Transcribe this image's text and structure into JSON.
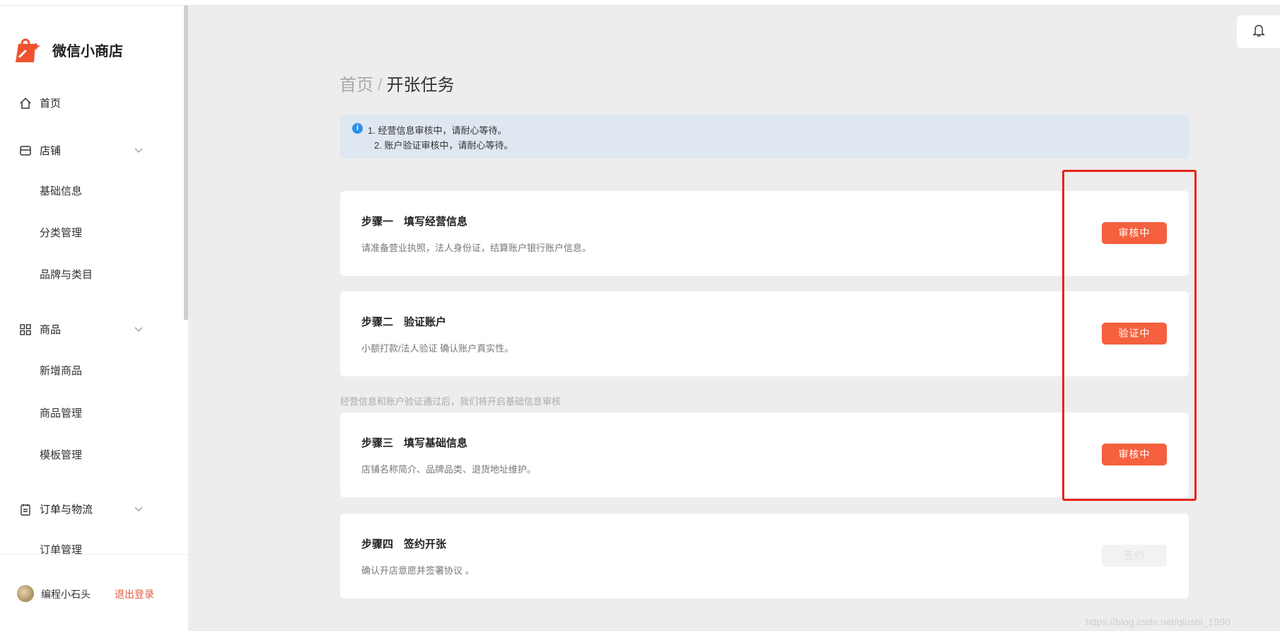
{
  "app": {
    "title": "微信小商店"
  },
  "sidebar": {
    "home": "首页",
    "store": {
      "label": "店铺",
      "items": [
        "基础信息",
        "分类管理",
        "品牌与类目"
      ]
    },
    "goods": {
      "label": "商品",
      "items": [
        "新增商品",
        "商品管理",
        "模板管理"
      ]
    },
    "orders": {
      "label": "订单与物流",
      "items": [
        "订单管理"
      ]
    },
    "footer": {
      "username": "编程小石头",
      "logout": "退出登录"
    }
  },
  "breadcrumb": {
    "home": "首页",
    "separator": "/",
    "current": "开张任务"
  },
  "notice": {
    "icon": "info-icon",
    "lines": [
      "1. 经营信息审核中，请耐心等待。",
      "2. 账户验证审核中，请耐心等待。"
    ]
  },
  "steps": [
    {
      "title": "步骤一　填写经营信息",
      "desc": "请准备营业执照，法人身份证，结算账户银行账户信息。",
      "button": "审核中"
    },
    {
      "title": "步骤二　验证账户",
      "desc": "小额打款/法人验证 确认账户真实性。",
      "button": "验证中"
    },
    {
      "title": "步骤三　填写基础信息",
      "desc": "店铺名称简介、品牌品类、退货地址维护。",
      "button": "审核中"
    },
    {
      "title": "步骤四　签约开张",
      "desc": "确认开店意愿并签署协议 。",
      "button": "签约"
    }
  ],
  "between_note": "经营信息和账户验证通过后，我们将开启基础信息审核",
  "watermark": "https://blog.csdn.net/qiushi_1990",
  "colors": {
    "accent": "#f5603f",
    "highlight": "#e8241b",
    "info": "#2b8ee8"
  }
}
